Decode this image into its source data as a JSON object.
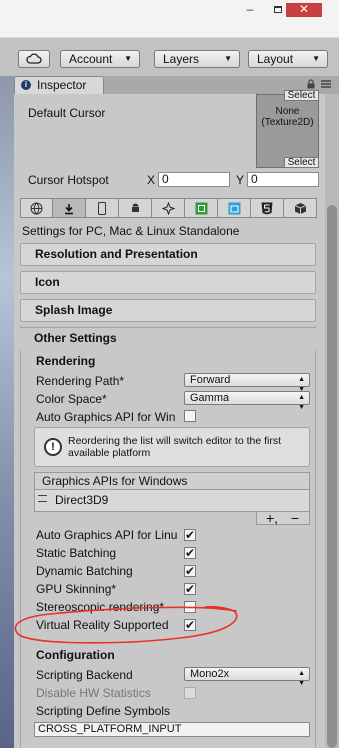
{
  "window": {
    "minimize": "–",
    "close": "✕"
  },
  "toolbar": {
    "cloud_icon": "cloud-icon",
    "account_label": "Account",
    "layers_label": "Layers",
    "layout_label": "Layout",
    "dropdown_arrow": "▼"
  },
  "inspector_tab": {
    "label": "Inspector",
    "icon": "i"
  },
  "cursor": {
    "default_cursor_label": "Default Cursor",
    "texture_value": "None (Texture2D)",
    "select_label": "Select",
    "hotspot_label": "Cursor Hotspot",
    "x_label": "X",
    "x_value": "0",
    "y_label": "Y",
    "y_value": "0"
  },
  "platform_tabs": [
    {
      "icon": "globe-icon",
      "glyph": "🌐"
    },
    {
      "icon": "download-icon",
      "glyph": "⬇"
    },
    {
      "icon": "phone-icon",
      "glyph": "▯"
    },
    {
      "icon": "android-icon",
      "glyph": "✤"
    },
    {
      "icon": "unity-icon",
      "glyph": "✷"
    },
    {
      "icon": "xbox-icon",
      "glyph": "▣"
    },
    {
      "icon": "windows-store-icon",
      "glyph": "▦"
    },
    {
      "icon": "html5-icon",
      "glyph": "5"
    },
    {
      "icon": "cube-icon",
      "glyph": "◧"
    }
  ],
  "settings_for": "Settings for PC, Mac & Linux Standalone",
  "foldouts": {
    "resolution": "Resolution and Presentation",
    "icon": "Icon",
    "splash": "Splash Image",
    "other": "Other Settings"
  },
  "rendering": {
    "section_title": "Rendering",
    "rendering_path_label": "Rendering Path*",
    "rendering_path_value": "Forward",
    "color_space_label": "Color Space*",
    "color_space_value": "Gamma",
    "auto_gapi_win_label": "Auto Graphics API for Win",
    "auto_gapi_win_checked": false,
    "help_text": "Reordering the list will switch editor to the first available platform",
    "help_icon": "!",
    "gapi_list_title": "Graphics APIs for Windows",
    "gapi_items": [
      "Direct3D9"
    ],
    "add_label": "+,",
    "remove_label": "−",
    "auto_gapi_linux_label": "Auto Graphics API for Linu",
    "auto_gapi_linux_checked": true,
    "static_batching_label": "Static Batching",
    "static_batching_checked": true,
    "dynamic_batching_label": "Dynamic Batching",
    "dynamic_batching_checked": true,
    "gpu_skinning_label": "GPU Skinning*",
    "gpu_skinning_checked": true,
    "stereo_label": "Stereoscopic rendering*",
    "stereo_checked": false,
    "vr_label": "Virtual Reality Supported",
    "vr_checked": true,
    "check_glyph": "✔"
  },
  "configuration": {
    "section_title": "Configuration",
    "scripting_backend_label": "Scripting Backend",
    "scripting_backend_value": "Mono2x",
    "disable_hw_stats_label": "Disable HW Statistics",
    "define_symbols_label": "Scripting Define Symbols",
    "define_symbols_value": "CROSS_PLATFORM_INPUT"
  },
  "colors": {
    "annotation": "#e8332a",
    "close_button": "#c94040"
  }
}
